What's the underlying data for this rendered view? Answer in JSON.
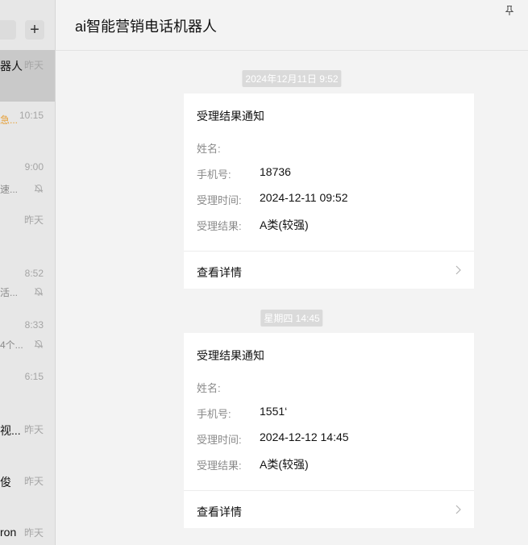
{
  "sidebar": {
    "add_label": "+",
    "conversations": [
      {
        "title": "器人",
        "time": "昨天",
        "preview": "",
        "muted": false,
        "active": true,
        "warn": false
      },
      {
        "title": "",
        "time": "10:15",
        "preview": "急...",
        "muted": false,
        "active": false,
        "warn": true
      },
      {
        "title": "",
        "time": "9:00",
        "preview": "速...",
        "muted": true,
        "active": false,
        "warn": false
      },
      {
        "title": "",
        "time": "昨天",
        "preview": "",
        "muted": false,
        "active": false,
        "warn": false
      },
      {
        "title": "",
        "time": "8:52",
        "preview": "活...",
        "muted": true,
        "active": false,
        "warn": false
      },
      {
        "title": "",
        "time": "8:33",
        "preview": "4个...",
        "muted": true,
        "active": false,
        "warn": false
      },
      {
        "title": "",
        "time": "6:15",
        "preview": "",
        "muted": false,
        "active": false,
        "warn": false
      },
      {
        "title": "视...",
        "time": "昨天",
        "preview": "",
        "muted": false,
        "active": false,
        "warn": false
      },
      {
        "title": "俊",
        "time": "昨天",
        "preview": "",
        "muted": false,
        "active": false,
        "warn": false
      },
      {
        "title": "ron",
        "time": "昨天",
        "preview": "",
        "muted": false,
        "active": false,
        "warn": false
      }
    ]
  },
  "header": {
    "title": "ai智能营销电话机器人"
  },
  "messages": [
    {
      "timestamp": "2024年12月11日 9:52",
      "card_title": "受理结果通知",
      "fields": [
        {
          "label": "姓名:",
          "value": ""
        },
        {
          "label": "手机号:",
          "value": "18736"
        },
        {
          "label": "受理时间:",
          "value": "2024-12-11 09:52"
        },
        {
          "label": "受理结果:",
          "value": "A类(较强)"
        }
      ],
      "detail_label": "查看详情"
    },
    {
      "timestamp": "星期四 14:45",
      "card_title": "受理结果通知",
      "fields": [
        {
          "label": "姓名:",
          "value": ""
        },
        {
          "label": "手机号:",
          "value": "1551‘"
        },
        {
          "label": "受理时间:",
          "value": "2024-12-12 14:45"
        },
        {
          "label": "受理结果:",
          "value": "A类(较强)"
        }
      ],
      "detail_label": "查看详情"
    }
  ]
}
